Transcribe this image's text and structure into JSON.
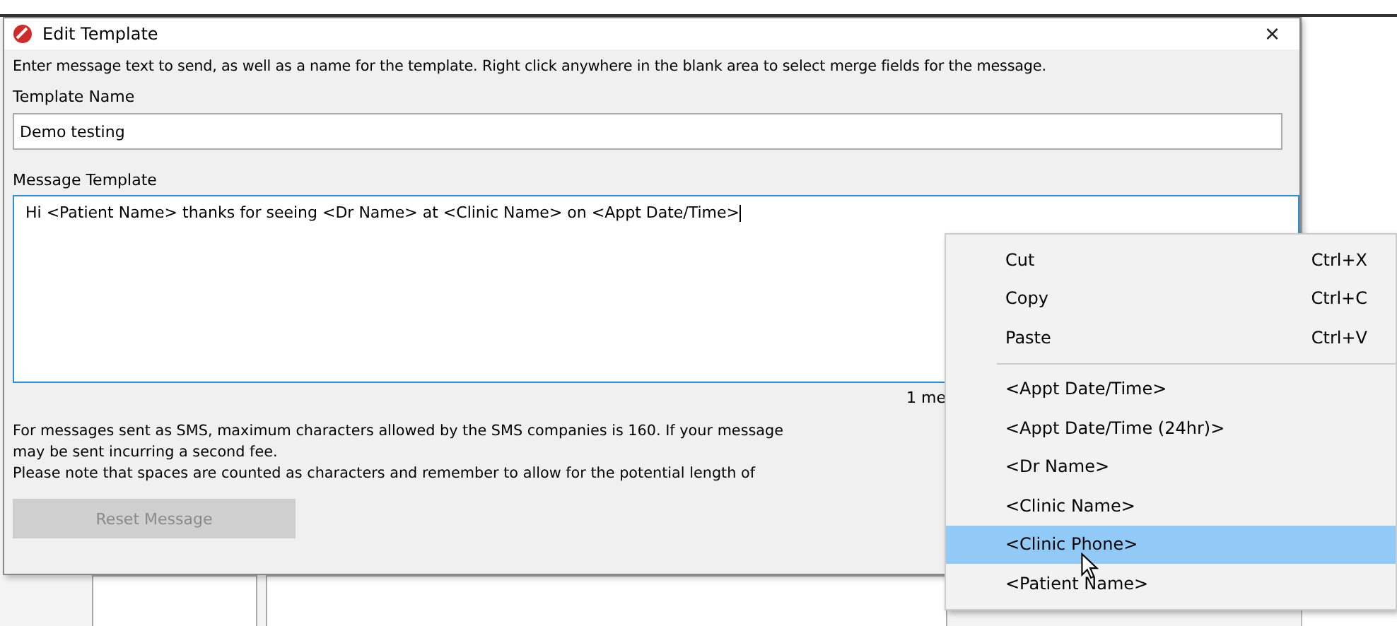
{
  "window": {
    "title": "Edit Template",
    "close": "×"
  },
  "instructions": "Enter message text to send, as well as a name for the template. Right click anywhere in the blank area to select merge fields for the message.",
  "template_name": {
    "label": "Template Name",
    "value": "Demo testing"
  },
  "message_template": {
    "label": "Message Template",
    "value": "Hi <Patient Name> thanks for seeing <Dr Name> at <Clinic Name> on <Appt Date/Time>"
  },
  "message_count": "1 me",
  "notes": [
    "For messages sent as SMS, maximum characters allowed by the SMS companies is 160. If your message",
    "may be sent incurring a second fee.",
    "Please note that spaces are counted as characters and remember to allow for the potential length of"
  ],
  "reset_button": {
    "label": "Reset Message",
    "disabled": true
  },
  "context_menu": [
    {
      "kind": "command",
      "label": "Cut",
      "shortcut": "Ctrl+X",
      "selected": false
    },
    {
      "kind": "command",
      "label": "Copy",
      "shortcut": "Ctrl+C",
      "selected": false
    },
    {
      "kind": "command",
      "label": "Paste",
      "shortcut": "Ctrl+V",
      "selected": false
    },
    {
      "kind": "separator"
    },
    {
      "kind": "field",
      "label": "<Appt Date/Time>",
      "selected": false
    },
    {
      "kind": "field",
      "label": "<Appt Date/Time (24hr)>",
      "selected": false
    },
    {
      "kind": "field",
      "label": "<Dr Name>",
      "selected": false
    },
    {
      "kind": "field",
      "label": "<Clinic Name>",
      "selected": false
    },
    {
      "kind": "field",
      "label": "<Clinic Phone>",
      "selected": true
    },
    {
      "kind": "field",
      "label": "<Patient Name>",
      "selected": false
    }
  ]
}
